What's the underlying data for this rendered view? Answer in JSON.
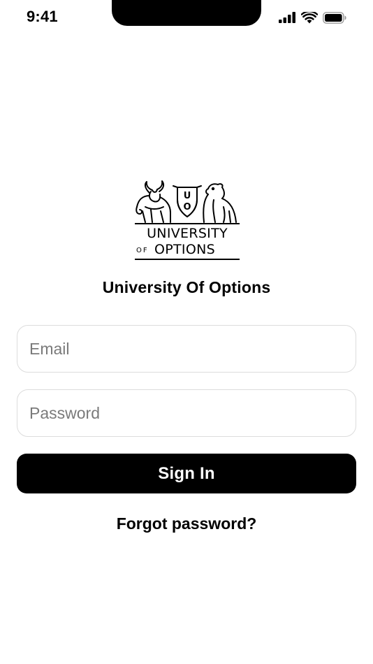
{
  "status_bar": {
    "time": "9:41",
    "icons": [
      "cellular-signal-icon",
      "wifi-icon",
      "battery-icon"
    ]
  },
  "logo": {
    "monogram_top": "U",
    "monogram_bottom": "O",
    "line1": "UNIVERSITY",
    "line2_small": "OF",
    "line2": "OPTIONS",
    "icons": [
      "bull-icon",
      "shield-icon",
      "bear-icon"
    ]
  },
  "app": {
    "title": "University Of Options"
  },
  "form": {
    "email_placeholder": "Email",
    "email_value": "",
    "password_placeholder": "Password",
    "password_value": "",
    "sign_in_label": "Sign In",
    "forgot_label": "Forgot password?"
  },
  "colors": {
    "background": "#ffffff",
    "primary": "#000000",
    "field_border": "#dcdcdc",
    "placeholder": "#7a7a7a"
  }
}
